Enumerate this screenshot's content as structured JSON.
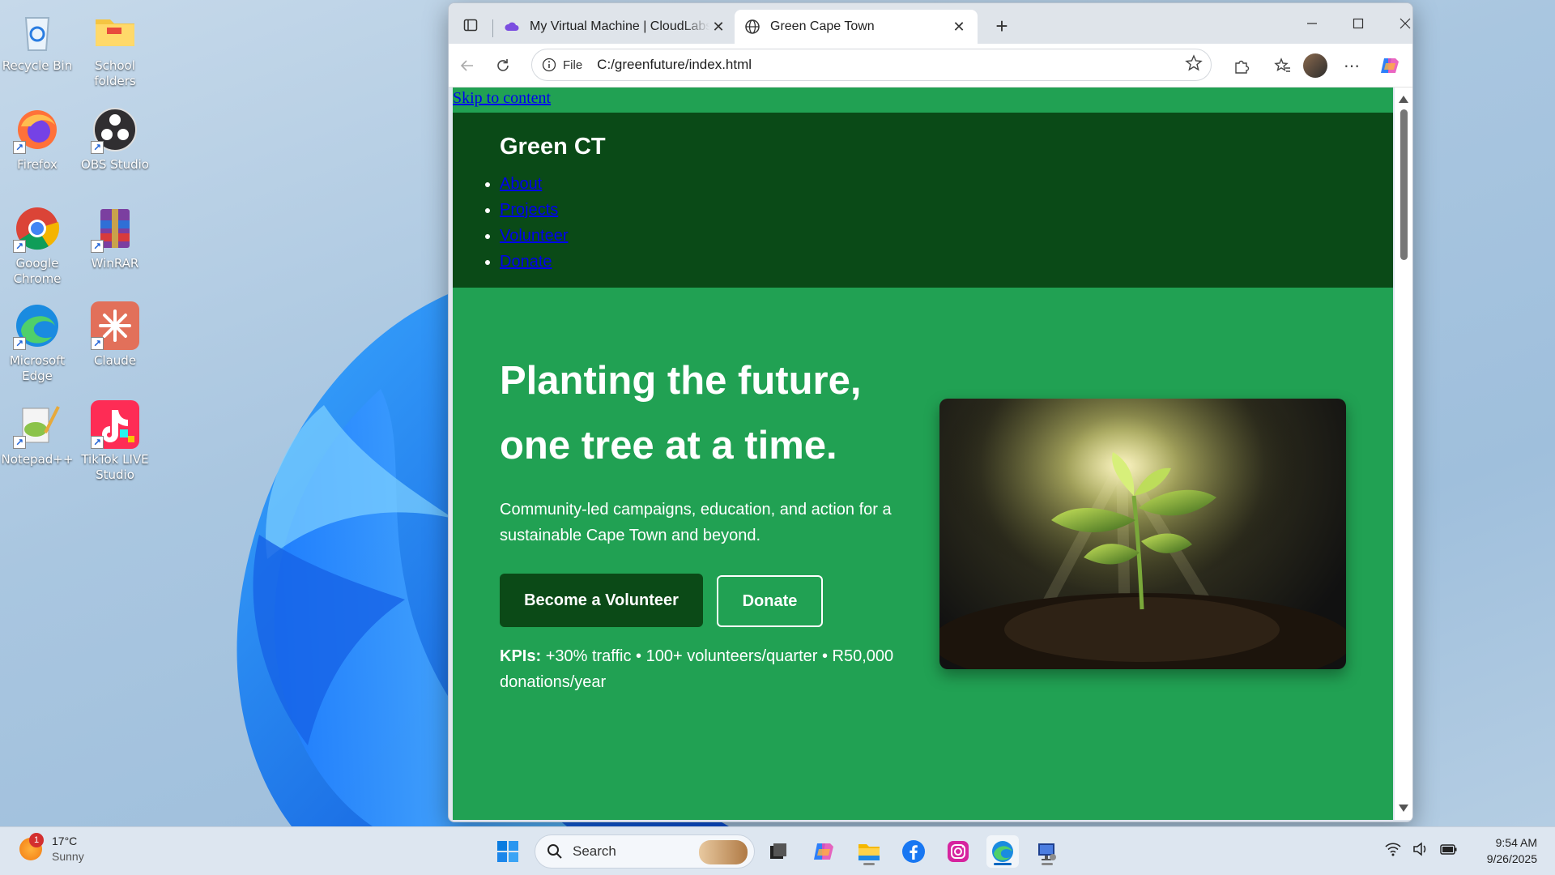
{
  "desktop": {
    "icons": [
      {
        "label": "Recycle Bin"
      },
      {
        "label": "School folders"
      },
      {
        "label": "Firefox"
      },
      {
        "label": "OBS Studio"
      },
      {
        "label": "Google Chrome"
      },
      {
        "label": "WinRAR"
      },
      {
        "label": "Microsoft Edge"
      },
      {
        "label": "Claude"
      },
      {
        "label": "Notepad++"
      },
      {
        "label": "TikTok LIVE Studio"
      }
    ]
  },
  "browser": {
    "tabs": [
      {
        "title": "My Virtual Machine | CloudLabs Portal"
      },
      {
        "title": "Green Cape Town"
      }
    ],
    "address": {
      "scheme": "File",
      "url": "C:/greenfuture/index.html"
    }
  },
  "page": {
    "skip_link": "Skip to content",
    "brand": "Green CT",
    "nav": [
      "About",
      "Projects",
      "Volunteer",
      "Donate"
    ],
    "hero": {
      "title": "Planting the future, one tree at a time.",
      "subtitle": "Community-led campaigns, education, and action for a sustainable Cape Town and beyond.",
      "primary_button": "Become a Volunteer",
      "secondary_button": "Donate",
      "kpi_label": "KPIs:",
      "kpi_text": "+30% traffic • 100+ volunteers/quarter • R50,000 donations/year",
      "image_icon": "seedling-photo"
    },
    "colors": {
      "page_green": "#21a153",
      "header_green": "#0a4a17"
    }
  },
  "taskbar": {
    "weather": {
      "temp": "17°C",
      "condition": "Sunny",
      "badge": "1"
    },
    "search_placeholder": "Search",
    "time": "9:54 AM",
    "date": "9/26/2025"
  }
}
